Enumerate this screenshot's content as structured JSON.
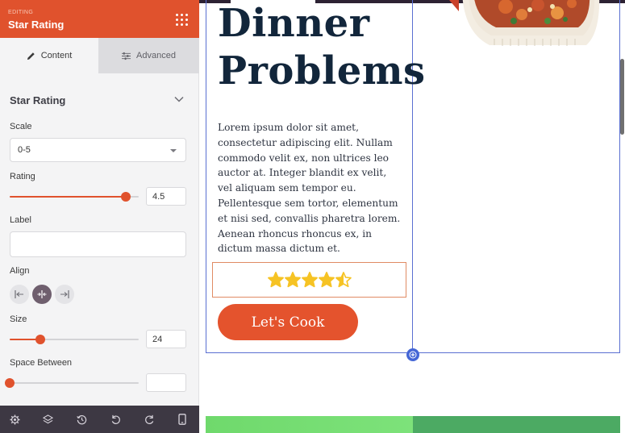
{
  "panel": {
    "editing_label": "EDITING",
    "title": "Star Rating",
    "tabs": [
      {
        "label": "Content",
        "icon": "pencil-icon",
        "active": true
      },
      {
        "label": "Advanced",
        "icon": "sliders-icon",
        "active": false
      }
    ],
    "section_title": "Star Rating",
    "fields": {
      "scale": {
        "label": "Scale",
        "value": "0-5"
      },
      "rating": {
        "label": "Rating",
        "value": "4.5",
        "fill_fraction": 0.9
      },
      "label": {
        "label": "Label",
        "value": ""
      },
      "align": {
        "label": "Align",
        "options": [
          "left",
          "center",
          "right"
        ],
        "selected": "center"
      },
      "size": {
        "label": "Size",
        "value": "24",
        "fill_fraction": 0.24
      },
      "space_between": {
        "label": "Space Between",
        "value": "",
        "fill_fraction": 0
      }
    },
    "bottom_icons": [
      "settings-icon",
      "layers-icon",
      "history-icon",
      "undo-icon",
      "redo-icon",
      "responsive-icon"
    ]
  },
  "canvas": {
    "headline_line1": "Dinner",
    "headline_line2": "Problems",
    "body": "Lorem ipsum dolor sit amet, consectetur adipiscing elit. Nullam commodo velit ex, non ultrices leo auctor at. Integer blandit ex velit, vel aliquam sem tempor eu. Pellentesque sem tortor, elementum et nisi sed, convallis pharetra lorem. Aenean rhoncus rhoncus ex, in dictum massa dictum et.",
    "rating": {
      "value": 4.5,
      "scale": 5
    },
    "button_label": "Let's Cook"
  },
  "colors": {
    "accent": "#e0522d",
    "headline": "#12263b",
    "star": "#f6c324",
    "outline": "#5a6fd1",
    "dark_bar": "#3d3843"
  }
}
